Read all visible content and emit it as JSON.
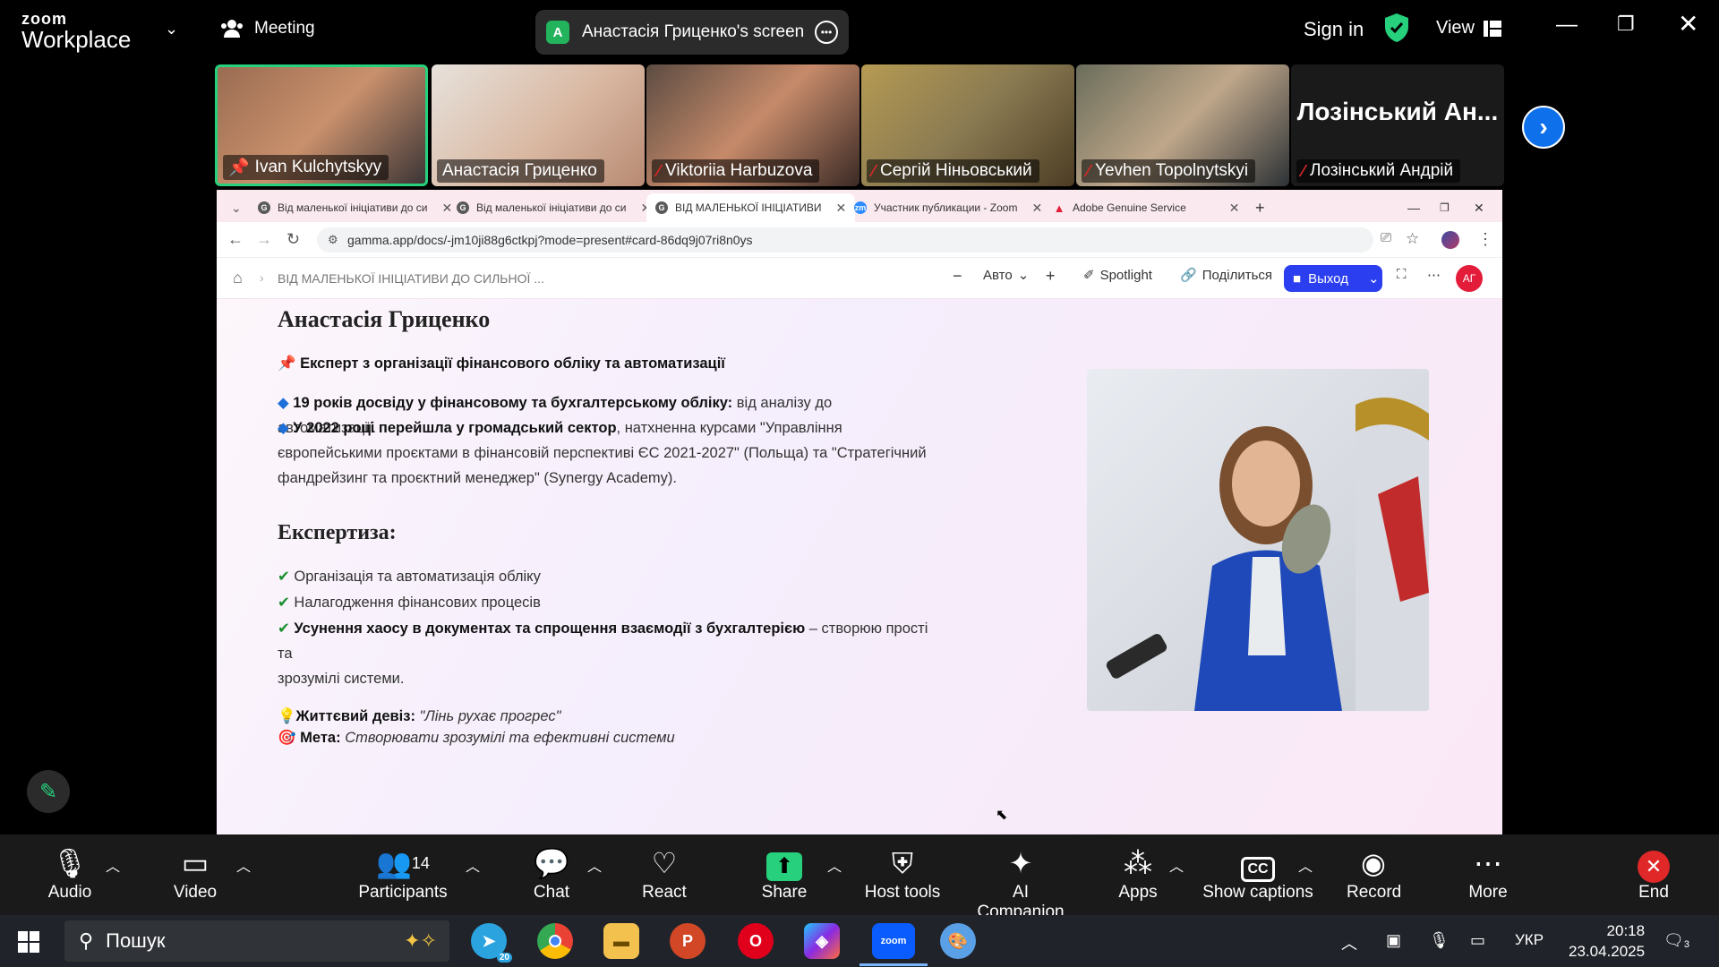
{
  "zoom": {
    "logo_top": "zoom",
    "logo_bottom": "Workplace",
    "meeting_label": "Meeting",
    "screen_avatar": "A",
    "screen_label": "Анастасія Гриценко's screen",
    "sign_in": "Sign in",
    "view_label": "View"
  },
  "participants": [
    {
      "name": "Ivan Kulchytskyy",
      "pinned": true,
      "muted": false
    },
    {
      "name": "Анастасія Гриценко",
      "pinned": false,
      "muted": false
    },
    {
      "name": "Viktoriia Harbuzova",
      "pinned": false,
      "muted": true
    },
    {
      "name": "Сергій Ніньовський",
      "pinned": false,
      "muted": true
    },
    {
      "name": "Yevhen Topolnytskyi",
      "pinned": false,
      "muted": true
    },
    {
      "name": "Лозінський Андрій",
      "big_label": "Лозінський Ан...",
      "pinned": false,
      "muted": true
    }
  ],
  "browser": {
    "tabs": [
      {
        "label": "Від маленької ініціативи до си",
        "icon": "G"
      },
      {
        "label": "Від маленької ініціативи до си",
        "icon": "G"
      },
      {
        "label": "ВІД МАЛЕНЬКОЇ ІНІЦІАТИВИ",
        "icon": "G"
      },
      {
        "label": "Участник публикации - Zoom",
        "icon": "zm"
      },
      {
        "label": "Adobe Genuine Service",
        "icon": "▲"
      }
    ],
    "url": "gamma.app/docs/-jm10ji88g6ctkpj?mode=present#card-86dq9j07ri8n0ys"
  },
  "gamma": {
    "breadcrumb": "ВІД МАЛЕНЬКОЇ ІНІЦІАТИВИ ДО СИЛЬНОЇ ...",
    "zoom_mode": "Авто",
    "spotlight": "Spotlight",
    "share": "Поділиться",
    "exit": "Выход",
    "avatar": "АГ"
  },
  "slide": {
    "name": "Анастасія Гриценко",
    "expert_bold": "Експерт з організації фінансового обліку та автоматизації",
    "exp_bold": "19 років досвіду у фінансовому та бухгалтерському обліку:",
    "exp_rest": " від аналізу до автоматизації.",
    "public_bold": "У 2022 році перейшла у громадський сектор",
    "public_rest": ", натхненна курсами \"Управління",
    "public_line2": "європейськими проєктами в фінансовій перспективі ЄС 2021-2027\" (Польща) та \"Стратегічний",
    "public_line3": "фандрейзинг та проєктний менеджер\" (Synergy Academy).",
    "expertise_title": "Експертиза:",
    "item1": "Організація та автоматизація обліку",
    "item2": "Налагодження фінансових процесів",
    "item3_bold": "Усунення хаосу в документах та спрощення взаємодії з бухгалтерією",
    "item3_rest": " – створюю прості та",
    "item3_line2": "зрозумілі системи.",
    "motto_label": "Життєвий девіз:",
    "motto": " \"Лінь рухає прогрес\"",
    "goal_label": "Мета:",
    "goal": " Створювати зрозумілі та ефективні системи"
  },
  "toolbar": {
    "audio": "Audio",
    "video": "Video",
    "participants": "Participants",
    "participants_count": "14",
    "chat": "Chat",
    "react": "React",
    "share": "Share",
    "host_tools": "Host tools",
    "ai_companion": "AI Companion",
    "apps": "Apps",
    "show_captions": "Show captions",
    "record": "Record",
    "more": "More",
    "end": "End"
  },
  "taskbar": {
    "search_placeholder": "Пошук",
    "telegram_badge": "20",
    "lang": "УКР",
    "time": "20:18",
    "date": "23.04.2025",
    "notifications": "3"
  },
  "colors": {
    "zoom_green": "#26d07c",
    "zoom_blue": "#0e71eb",
    "gamma_blue": "#2b3ff0",
    "end_red": "#e02828"
  }
}
